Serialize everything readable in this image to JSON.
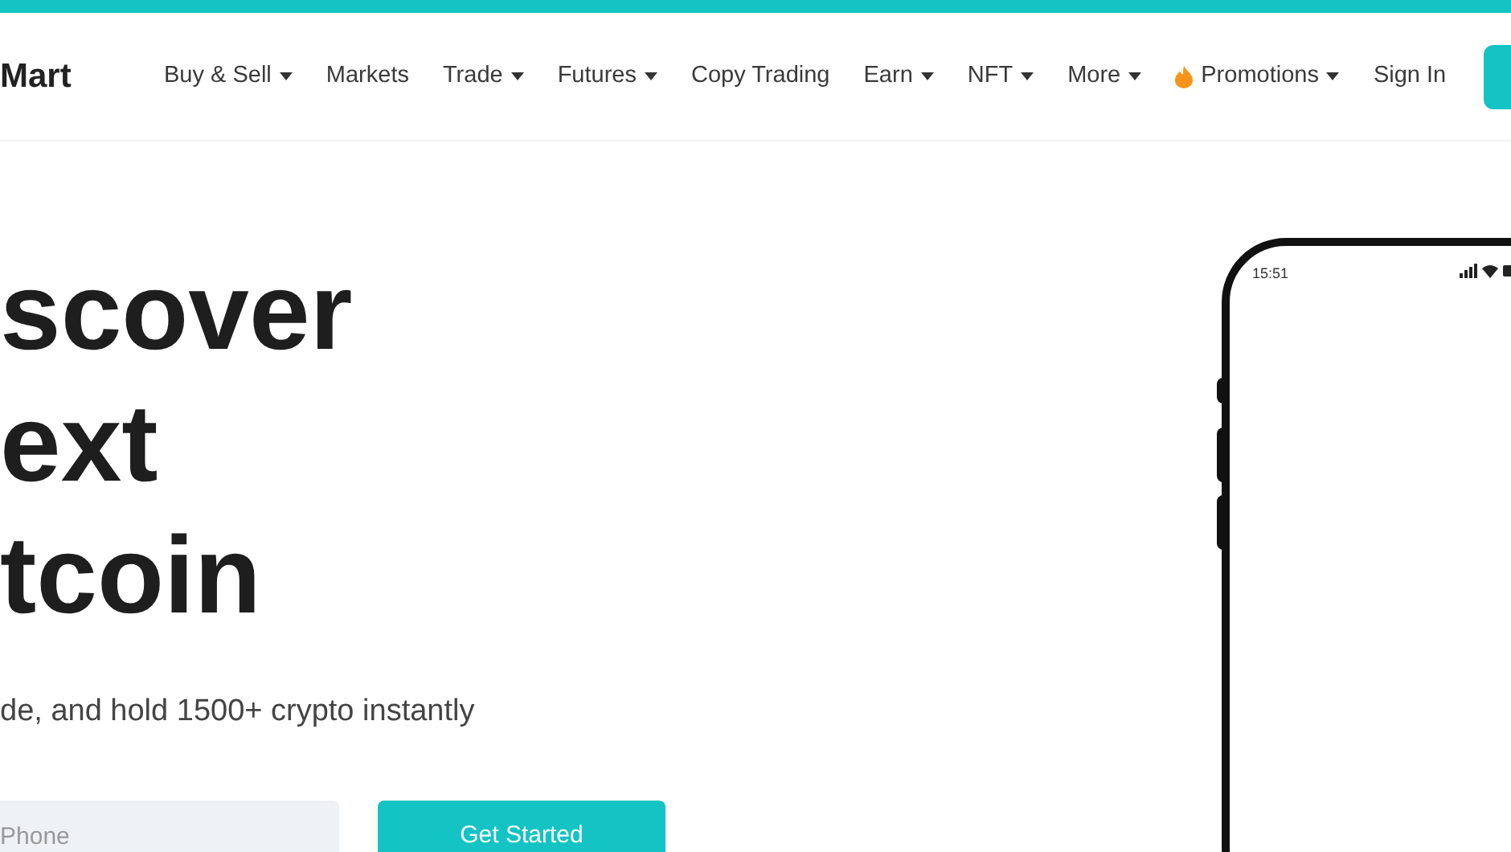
{
  "header": {
    "logo": "Mart",
    "nav": [
      {
        "label": "Buy & Sell",
        "dropdown": true,
        "kind": "link"
      },
      {
        "label": "Markets",
        "dropdown": false,
        "kind": "link"
      },
      {
        "label": "Trade",
        "dropdown": true,
        "kind": "link"
      },
      {
        "label": "Futures",
        "dropdown": true,
        "kind": "link"
      },
      {
        "label": "Copy Trading",
        "dropdown": false,
        "kind": "link"
      },
      {
        "label": "Earn",
        "dropdown": true,
        "kind": "link"
      },
      {
        "label": "NFT",
        "dropdown": true,
        "kind": "link"
      },
      {
        "label": "More",
        "dropdown": true,
        "kind": "link"
      },
      {
        "label": "Promotions",
        "dropdown": true,
        "kind": "promo"
      },
      {
        "label": "Sign In",
        "dropdown": false,
        "kind": "link"
      }
    ]
  },
  "hero": {
    "headline": [
      "scover",
      "ext",
      "tcoin"
    ],
    "subtitle": "de, and hold 1500+ crypto instantly",
    "input": {
      "placeholder": "Phone"
    },
    "button": "Get Started"
  },
  "phone": {
    "time": "15:51"
  }
}
